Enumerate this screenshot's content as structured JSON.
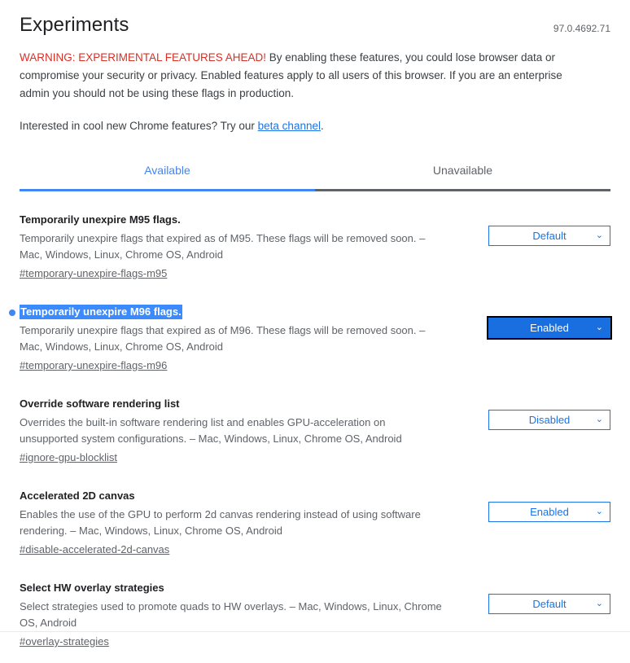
{
  "header": {
    "title": "Experiments",
    "version": "97.0.4692.71"
  },
  "warning": {
    "lead": "WARNING: EXPERIMENTAL FEATURES AHEAD!",
    "body": " By enabling these features, you could lose browser data or compromise your security or privacy. Enabled features apply to all users of this browser. If you are an enterprise admin you should not be using these flags in production.",
    "beta_prefix": "Interested in cool new Chrome features? Try our ",
    "beta_link": "beta channel",
    "beta_suffix": "."
  },
  "tabs": [
    {
      "label": "Available",
      "selected": true
    },
    {
      "label": "Unavailable",
      "selected": false
    }
  ],
  "select_options": [
    "Default",
    "Enabled",
    "Disabled"
  ],
  "experiments": [
    {
      "title": "Temporarily unexpire M95 flags.",
      "description": "Temporarily unexpire flags that expired as of M95. These flags will be removed soon. – Mac, Windows, Linux, Chrome OS, Android",
      "permalink": "#temporary-unexpire-flags-m95",
      "value": "Default",
      "highlighted": false,
      "dot": false,
      "focused": false
    },
    {
      "title": "Temporarily unexpire M96 flags.",
      "description": "Temporarily unexpire flags that expired as of M96. These flags will be removed soon. – Mac, Windows, Linux, Chrome OS, Android",
      "permalink": "#temporary-unexpire-flags-m96",
      "value": "Enabled",
      "highlighted": true,
      "dot": true,
      "focused": true
    },
    {
      "title": "Override software rendering list",
      "description": "Overrides the built-in software rendering list and enables GPU-acceleration on unsupported system configurations. – Mac, Windows, Linux, Chrome OS, Android",
      "permalink": "#ignore-gpu-blocklist",
      "value": "Disabled",
      "highlighted": false,
      "dot": false,
      "focused": false
    },
    {
      "title": "Accelerated 2D canvas",
      "description": "Enables the use of the GPU to perform 2d canvas rendering instead of using software rendering. – Mac, Windows, Linux, Chrome OS, Android",
      "permalink": "#disable-accelerated-2d-canvas",
      "value": "Enabled",
      "highlighted": false,
      "dot": false,
      "focused": false
    },
    {
      "title": "Select HW overlay strategies",
      "description": "Select strategies used to promote quads to HW overlays. – Mac, Windows, Linux, Chrome OS, Android",
      "permalink": "#overlay-strategies",
      "value": "Default",
      "highlighted": false,
      "dot": false,
      "focused": false
    }
  ],
  "icons": {
    "chevron_down": "⌄"
  },
  "colors": {
    "accent": "#1a73e8",
    "tab_accent": "#4285f4",
    "warning": "#d93025",
    "selection": "#3b8bff",
    "text_primary": "#202124",
    "text_secondary": "#5f6368"
  }
}
